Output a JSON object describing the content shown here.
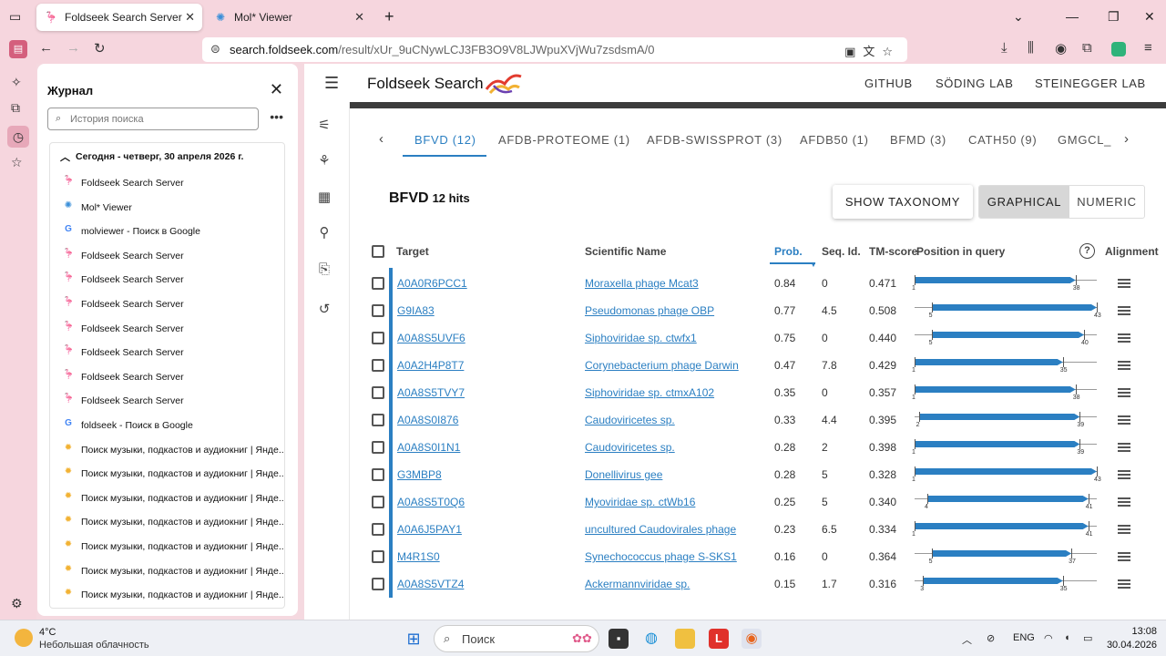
{
  "browser": {
    "tabs": [
      {
        "title": "Foldseek Search Server",
        "favicon": "foldseek-logo-icon",
        "active": true
      },
      {
        "title": "Mol* Viewer",
        "favicon": "molstar-icon",
        "active": false
      }
    ],
    "url_host": "search.foldseek.com",
    "url_path": "/result/xUr_9uCNywLCJ3FB3O9V8LJWpuXVjWu7zsdsmA/0"
  },
  "history": {
    "title": "Журнал",
    "search_placeholder": "История поиска",
    "group_label": "Сегодня - четверг, 30 апреля 2026 г.",
    "items": [
      {
        "label": "Foldseek Search Server",
        "icon": "foldseek"
      },
      {
        "label": "Mol* Viewer",
        "icon": "molstar"
      },
      {
        "label": "molviewer - Поиск в Google",
        "icon": "google"
      },
      {
        "label": "Foldseek Search Server",
        "icon": "foldseek"
      },
      {
        "label": "Foldseek Search Server",
        "icon": "foldseek"
      },
      {
        "label": "Foldseek Search Server",
        "icon": "foldseek"
      },
      {
        "label": "Foldseek Search Server",
        "icon": "foldseek"
      },
      {
        "label": "Foldseek Search Server",
        "icon": "foldseek"
      },
      {
        "label": "Foldseek Search Server",
        "icon": "foldseek"
      },
      {
        "label": "Foldseek Search Server",
        "icon": "foldseek"
      },
      {
        "label": "foldseek - Поиск в Google",
        "icon": "google"
      },
      {
        "label": "Поиск музыки, подкастов и аудиокниг | Янде...",
        "icon": "yandex"
      },
      {
        "label": "Поиск музыки, подкастов и аудиокниг | Янде...",
        "icon": "yandex"
      },
      {
        "label": "Поиск музыки, подкастов и аудиокниг | Янде...",
        "icon": "yandex"
      },
      {
        "label": "Поиск музыки, подкастов и аудиокниг | Янде...",
        "icon": "yandex"
      },
      {
        "label": "Поиск музыки, подкастов и аудиокниг | Янде...",
        "icon": "yandex"
      },
      {
        "label": "Поиск музыки, подкастов и аудиокниг | Янде...",
        "icon": "yandex"
      },
      {
        "label": "Поиск музыки, подкастов и аудиокниг | Янде...",
        "icon": "yandex"
      }
    ]
  },
  "app": {
    "brand": "Foldseek Search",
    "links": [
      "GITHUB",
      "SÖDING LAB",
      "STEINEGGER LAB"
    ],
    "db_tabs": [
      "BFVD (12)",
      "AFDB-PROTEOME (1)",
      "AFDB-SWISSPROT (3)",
      "AFDB50 (1)",
      "BFMD (3)",
      "CATH50 (9)",
      "GMGCL_"
    ],
    "result_db": "BFVD",
    "hits_label": "12 hits",
    "btn_taxonomy": "SHOW TAXONOMY",
    "btn_graphical": "GRAPHICAL",
    "btn_numeric": "NUMERIC",
    "help_symbol": "?",
    "columns": {
      "target": "Target",
      "sci_name": "Scientific Name",
      "prob": "Prob.",
      "seqid": "Seq. Id.",
      "tmscore": "TM-score",
      "position": "Position in query",
      "alignment": "Alignment"
    },
    "rows": [
      {
        "target": "A0A0R6PCC1",
        "name": "Moraxella phage Mcat3",
        "prob": "0.84",
        "seqid": "0",
        "tm": "0.471",
        "start": 1,
        "end": 38
      },
      {
        "target": "G9IA83",
        "name": "Pseudomonas phage OBP",
        "prob": "0.77",
        "seqid": "4.5",
        "tm": "0.508",
        "start": 5,
        "end": 43
      },
      {
        "target": "A0A8S5UVF6",
        "name": "Siphoviridae sp. ctwfx1",
        "prob": "0.75",
        "seqid": "0",
        "tm": "0.440",
        "start": 5,
        "end": 40
      },
      {
        "target": "A0A2H4P8T7",
        "name": "Corynebacterium phage Darwin",
        "prob": "0.47",
        "seqid": "7.8",
        "tm": "0.429",
        "start": 1,
        "end": 35
      },
      {
        "target": "A0A8S5TVY7",
        "name": "Siphoviridae sp. ctmxA102",
        "prob": "0.35",
        "seqid": "0",
        "tm": "0.357",
        "start": 1,
        "end": 38
      },
      {
        "target": "A0A8S0I876",
        "name": "Caudoviricetes sp.",
        "prob": "0.33",
        "seqid": "4.4",
        "tm": "0.395",
        "start": 2,
        "end": 39
      },
      {
        "target": "A0A8S0I1N1",
        "name": "Caudoviricetes sp.",
        "prob": "0.28",
        "seqid": "2",
        "tm": "0.398",
        "start": 1,
        "end": 39
      },
      {
        "target": "G3MBP8",
        "name": "Donellivirus gee",
        "prob": "0.28",
        "seqid": "5",
        "tm": "0.328",
        "start": 1,
        "end": 43
      },
      {
        "target": "A0A8S5T0Q6",
        "name": "Myoviridae sp. ctWb16",
        "prob": "0.25",
        "seqid": "5",
        "tm": "0.340",
        "start": 4,
        "end": 41
      },
      {
        "target": "A0A6J5PAY1",
        "name": "uncultured Caudovirales phage",
        "prob": "0.23",
        "seqid": "6.5",
        "tm": "0.334",
        "start": 1,
        "end": 41
      },
      {
        "target": "M4R1S0",
        "name": "Synechococcus phage S-SKS1",
        "prob": "0.16",
        "seqid": "0",
        "tm": "0.364",
        "start": 5,
        "end": 37
      },
      {
        "target": "A0A8S5VTZ4",
        "name": "Ackermannviridae sp.",
        "prob": "0.15",
        "seqid": "1.7",
        "tm": "0.316",
        "start": 3,
        "end": 35
      }
    ],
    "query_length": 43
  },
  "taskbar": {
    "temp": "4°C",
    "condition": "Небольшая облачность",
    "search_label": "Поиск",
    "lang": "ENG",
    "time": "13:08",
    "date": "30.04.2026"
  },
  "colors": {
    "accent": "#2b7fc2",
    "browser_chrome": "#f6d6de"
  }
}
